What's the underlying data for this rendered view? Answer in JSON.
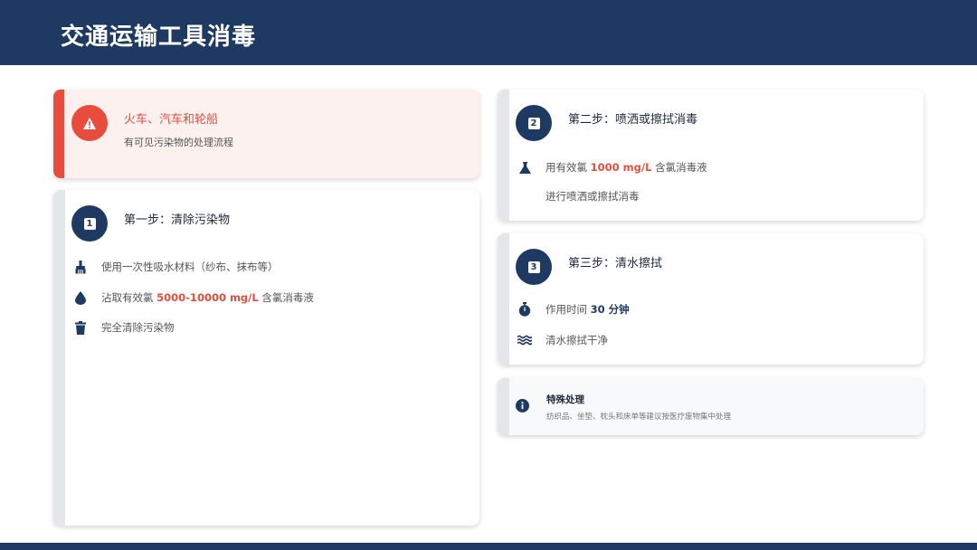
{
  "page": {
    "title": "交通运输工具消毒"
  },
  "alert_card": {
    "title": "火车、汽车和轮船",
    "subtitle": "有可见污染物的处理流程"
  },
  "step1": {
    "number": "1",
    "title": "第一步：清除污染物",
    "items": [
      {
        "icon": "brush-icon",
        "text": "使用一次性吸水材料（纱布、抹布等）"
      },
      {
        "icon": "water-drop-icon",
        "pre": "沾取有效氯 ",
        "highlight": "5000-10000 mg/L",
        "post": " 含氯消毒液"
      },
      {
        "icon": "trash-icon",
        "text": "完全清除污染物"
      }
    ]
  },
  "step2": {
    "number": "2",
    "title": "第二步：喷洒或擦拭消毒",
    "items": [
      {
        "icon": "flask-icon",
        "pre": "用有效氯 ",
        "highlight": "1000 mg/L",
        "post": " 含氯消毒液"
      },
      {
        "text": "进行喷洒或擦拭消毒"
      }
    ]
  },
  "step3": {
    "number": "3",
    "title": "第三步：清水擦拭",
    "items": [
      {
        "icon": "stopwatch-icon",
        "pre": "作用时间 ",
        "highlight": "30 分钟"
      },
      {
        "icon": "water-waves-icon",
        "text": "清水擦拭干净"
      }
    ]
  },
  "special": {
    "title": "特殊处理",
    "desc": "纺织品、坐垫、枕头和床单等建议按医疗废物集中处理"
  },
  "colors": {
    "navy": "#1e3a62",
    "accent_red": "#e74c3c",
    "alert_bg": "#fdf1f0",
    "stripe_gray": "#e4e6ea"
  }
}
